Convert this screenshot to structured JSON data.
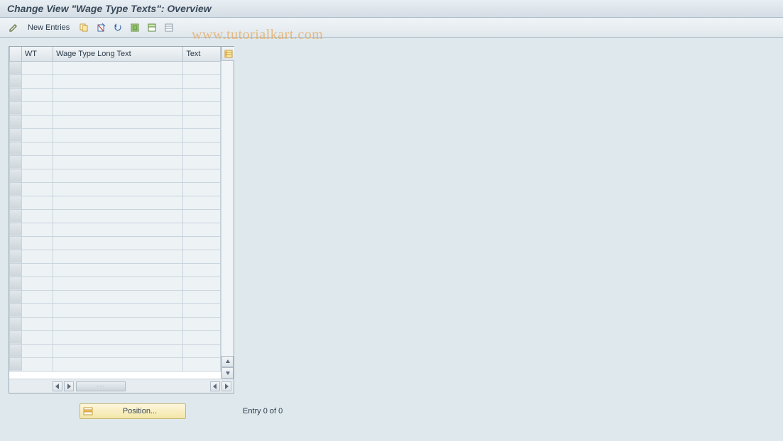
{
  "header": {
    "title": "Change View \"Wage Type Texts\": Overview"
  },
  "toolbar": {
    "new_entries_label": "New Entries"
  },
  "watermark": "www.tutorialkart.com",
  "table": {
    "columns": {
      "wt": "WT",
      "long": "Wage Type Long Text",
      "text": "Text"
    },
    "row_count": 23
  },
  "footer": {
    "position_label": "Position...",
    "entry_label": "Entry 0 of 0"
  }
}
